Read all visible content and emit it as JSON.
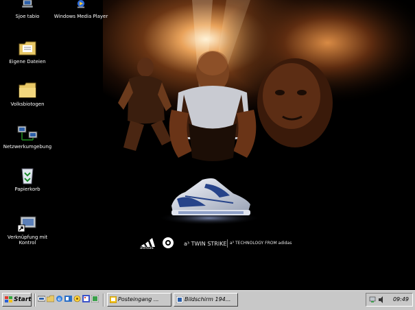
{
  "desktop": {
    "icons": [
      {
        "label": "Sjoe tabio",
        "icon": "my-computer-icon"
      },
      {
        "label": "Windows Media Player",
        "icon": "media-player-icon"
      },
      {
        "label": "Eigene Dateien",
        "icon": "my-documents-icon"
      },
      {
        "label": "Volksbiotogen",
        "icon": "folder-icon"
      },
      {
        "label": "Netzwerkumgebung",
        "icon": "network-icon"
      },
      {
        "label": "Papierkorb",
        "icon": "recycle-bin-icon"
      },
      {
        "label": "Verknüpfung mit Kontrol",
        "icon": "shortcut-icon"
      }
    ]
  },
  "wallpaper": {
    "brand_name": "adidas",
    "product": "a³ TWIN STRIKE",
    "slogan": "a³ TECHNOLOGY FROM adidas"
  },
  "taskbar": {
    "start_label": "Start",
    "quick_launch": [
      "show-desktop-icon",
      "explorer-icon",
      "ie-icon",
      "outlook-icon",
      "media-icon",
      "paint-icon",
      "app-icon"
    ],
    "tasks": [
      {
        "label": "Posteingang ...",
        "icon": "inbox-icon",
        "active": false
      },
      {
        "label": "Bildschirm 194...",
        "icon": "image-icon",
        "active": false
      }
    ],
    "clock": "09:49"
  },
  "colors": {
    "taskbar": "#c8c8c8",
    "desktop_bg": "#000000",
    "glow": "#d88a3a"
  }
}
